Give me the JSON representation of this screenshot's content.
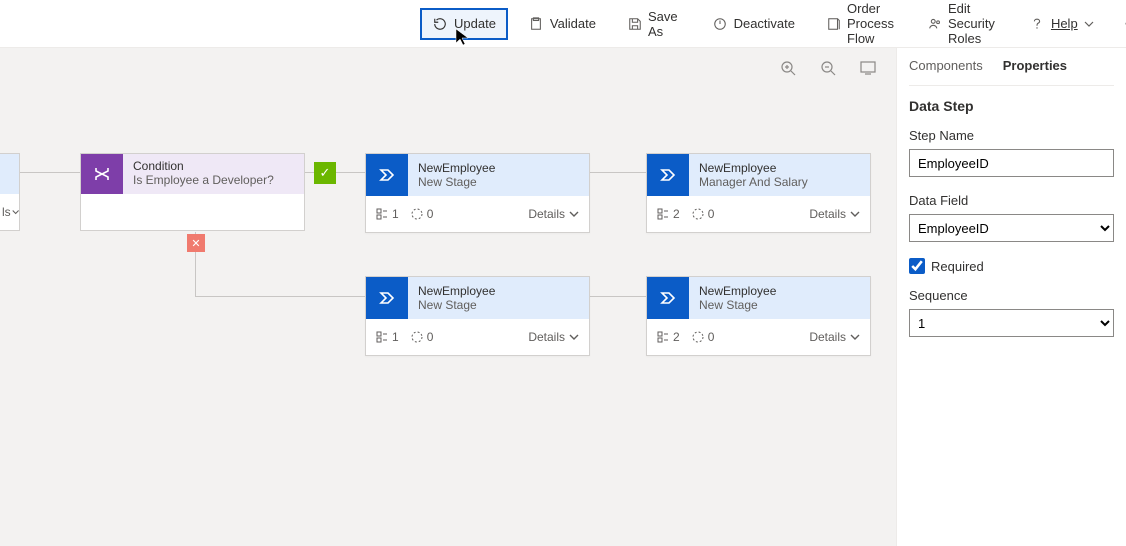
{
  "toolbar": {
    "update": "Update",
    "validate": "Validate",
    "save_as": "Save As",
    "deactivate": "Deactivate",
    "order_flow": "Order Process Flow",
    "edit_roles": "Edit Security Roles",
    "help": "Help"
  },
  "canvas": {
    "partial_left": {
      "details": "ls"
    },
    "condition": {
      "title": "Condition",
      "subtitle": "Is Employee a Developer?"
    },
    "stage_a": {
      "title": "NewEmployee",
      "subtitle": "New Stage",
      "steps_count": "1",
      "pending_count": "0",
      "details": "Details"
    },
    "stage_b": {
      "title": "NewEmployee",
      "subtitle": "Manager And Salary",
      "steps_count": "2",
      "pending_count": "0",
      "details": "Details"
    },
    "stage_c": {
      "title": "NewEmployee",
      "subtitle": "New Stage",
      "steps_count": "1",
      "pending_count": "0",
      "details": "Details"
    },
    "stage_d": {
      "title": "NewEmployee",
      "subtitle": "New Stage",
      "steps_count": "2",
      "pending_count": "0",
      "details": "Details"
    }
  },
  "panel": {
    "tabs": {
      "components": "Components",
      "properties": "Properties"
    },
    "heading": "Data Step",
    "step_name_label": "Step Name",
    "step_name_value": "EmployeeID",
    "data_field_label": "Data Field",
    "data_field_value": "EmployeeID",
    "required_label": "Required",
    "required_checked": true,
    "sequence_label": "Sequence",
    "sequence_value": "1"
  }
}
